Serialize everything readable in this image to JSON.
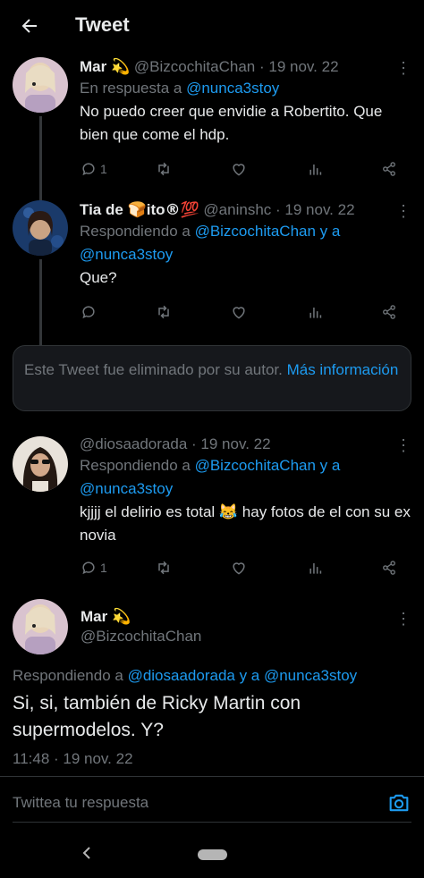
{
  "header": {
    "title": "Tweet"
  },
  "tweets": [
    {
      "name": "Mar",
      "name_emoji": "💫",
      "handle": "@BizcochitaChan",
      "date": "· 19 nov. 22",
      "reply_prefix": "En respuesta a",
      "reply_to": "@nunca3stoy",
      "text": "No puedo creer que envidie a Robertito. Que bien que come el hdp.",
      "replies": "1"
    },
    {
      "name": "Tia de",
      "name_suffix": "ito",
      "name_emoji_1": "🍞",
      "name_emoji_2": "®",
      "name_emoji_3": "💯",
      "handle": "@aninshc",
      "date": "· 19 nov. 22",
      "reply_prefix": "Respondiendo a",
      "reply_to": "@BizcochitaChan y a @nunca3stoy",
      "text": "Que?"
    },
    {
      "name": "",
      "handle": "@diosaadorada",
      "date": "· 19 nov. 22",
      "reply_prefix": "Respondiendo a",
      "reply_to": "@BizcochitaChan y a @nunca3stoy",
      "text": "kjjjj el delirio es total 😹 hay fotos de el con su ex novia",
      "replies": "1"
    }
  ],
  "deleted_notice": {
    "text": "Este Tweet fue eliminado por su autor.",
    "link": "Más información"
  },
  "main_tweet": {
    "name": "Mar",
    "name_emoji": "💫",
    "handle": "@BizcochitaChan",
    "reply_prefix": "Respondiendo a",
    "reply_to": "@diosaadorada y a @nunca3stoy",
    "text": "Si, si, también de Ricky Martin con supermodelos. Y?",
    "timestamp": "11:48 · 19 nov. 22"
  },
  "reply_bar": {
    "placeholder": "Twittea tu respuesta"
  },
  "colors": {
    "accent": "#1d9bf0",
    "muted": "#71767b",
    "background": "#000000"
  }
}
